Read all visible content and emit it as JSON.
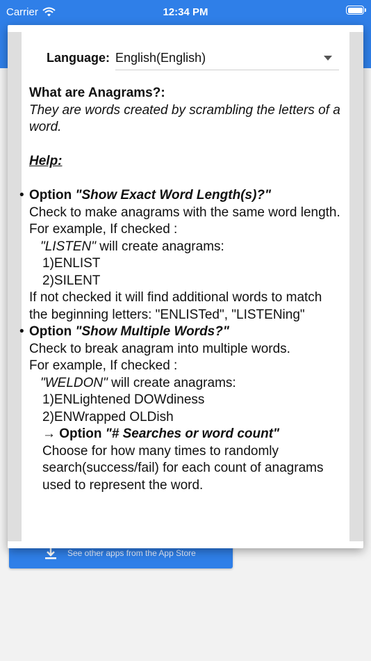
{
  "status_bar": {
    "carrier": "Carrier",
    "time": "12:34 PM"
  },
  "store_button": {
    "label": "See other apps from the App Store"
  },
  "dialog": {
    "language_label": "Language:",
    "language_value": "English(English)",
    "what_title": "What are Anagrams?:",
    "what_desc": "They are words created by scrambling the letters of a word.",
    "help_title": "Help:",
    "option1": {
      "prefix": "Option",
      "name": "\"Show Exact Word Length(s)?\"",
      "desc": "Check to make anagrams with the same word length.",
      "example_intro": "For example, If checked :",
      "example_word": "\"LISTEN\"",
      "example_suffix": " will create anagrams:",
      "results": [
        "1)ENLIST",
        "2)SILENT"
      ],
      "note": "If not checked it will find additional words to match the beginning letters: \"ENLISTed\", \"LISTENing\""
    },
    "option2": {
      "prefix": "Option",
      "name": "\"Show Multiple Words?\"",
      "desc": "Check to break anagram into multiple words.",
      "example_intro": "For example, If checked :",
      "example_word": "\"WELDON\"",
      "example_suffix": " will create anagrams:",
      "results": [
        "1)ENLightened DOWdiness",
        "2)ENWrapped OLDish"
      ],
      "sub_arrow": "→",
      "sub_prefix": "Option",
      "sub_name": "\"# Searches or word count\"",
      "sub_desc": "Choose for how many times to randomly search(success/fail) for each count of anagrams used to represent the word."
    }
  }
}
